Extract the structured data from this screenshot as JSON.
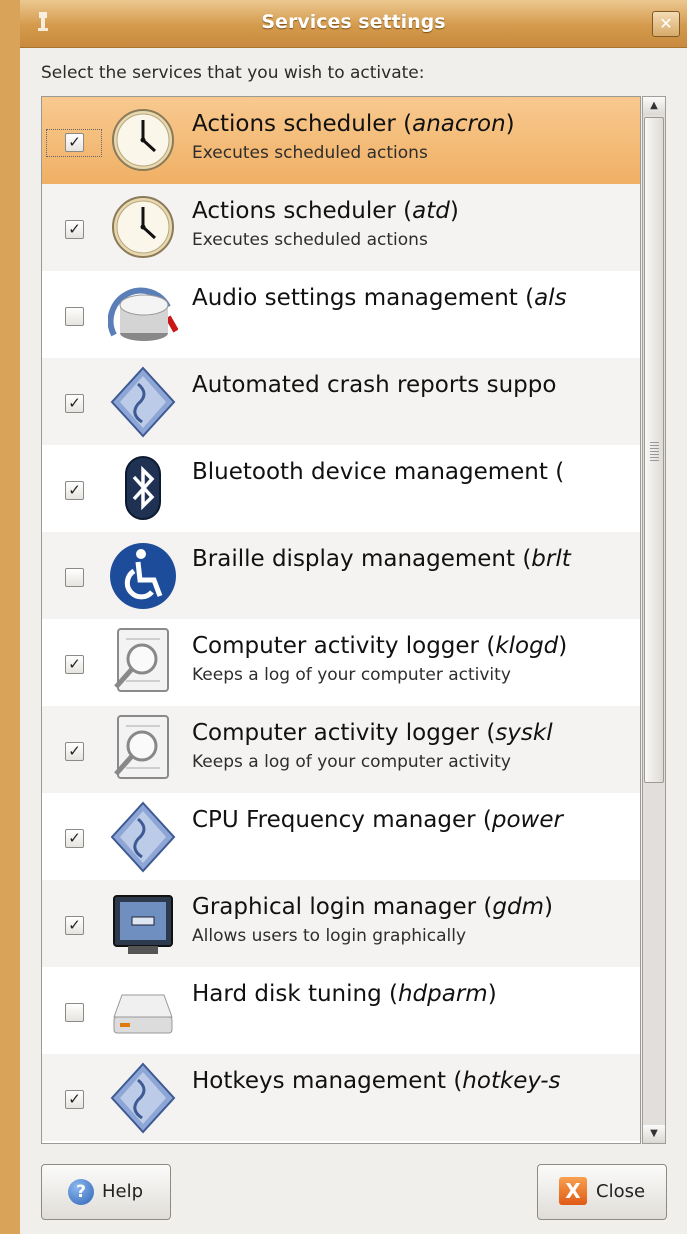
{
  "window": {
    "title": "Services settings",
    "close_glyph": "✕"
  },
  "prompt": "Select the services that you wish to activate:",
  "services": [
    {
      "name": "Actions scheduler (",
      "daemon": "anacron",
      "tail": ")",
      "desc": "Executes scheduled actions",
      "checked": true,
      "selected": true,
      "icon": "clock-icon"
    },
    {
      "name": "Actions scheduler (",
      "daemon": "atd",
      "tail": ")",
      "desc": "Executes scheduled actions",
      "checked": true,
      "icon": "clock-icon"
    },
    {
      "name": "Audio settings management (",
      "daemon": "als",
      "tail": "",
      "desc": "",
      "checked": false,
      "icon": "volume-knob-icon"
    },
    {
      "name": "Automated crash reports suppo",
      "daemon": "",
      "tail": "",
      "desc": "",
      "checked": true,
      "icon": "system-diamond-icon"
    },
    {
      "name": "Bluetooth device management (",
      "daemon": "",
      "tail": "",
      "desc": "",
      "checked": true,
      "icon": "bluetooth-icon"
    },
    {
      "name": "Braille display management (",
      "daemon": "brlt",
      "tail": "",
      "desc": "",
      "checked": false,
      "icon": "accessibility-icon"
    },
    {
      "name": "Computer activity logger (",
      "daemon": "klogd",
      "tail": ")",
      "desc": "Keeps a log of your computer activity",
      "checked": true,
      "icon": "log-viewer-icon"
    },
    {
      "name": "Computer activity logger (",
      "daemon": "syskl",
      "tail": "",
      "desc": "Keeps a log of your computer activity",
      "checked": true,
      "icon": "log-viewer-icon"
    },
    {
      "name": "CPU Frequency manager (",
      "daemon": "power",
      "tail": "",
      "desc": "",
      "checked": true,
      "icon": "system-diamond-icon"
    },
    {
      "name": "Graphical login manager (",
      "daemon": "gdm",
      "tail": ")",
      "desc": "Allows users to login graphically",
      "checked": true,
      "icon": "login-screen-icon"
    },
    {
      "name": "Hard disk tuning (",
      "daemon": "hdparm",
      "tail": ")",
      "desc": "",
      "checked": false,
      "icon": "hard-disk-icon"
    },
    {
      "name": "Hotkeys management (",
      "daemon": "hotkey-s",
      "tail": "",
      "desc": "",
      "checked": true,
      "icon": "system-diamond-icon"
    }
  ],
  "buttons": {
    "help_label": "Help",
    "close_label": "Close"
  },
  "colors": {
    "selected_row": "#f0b065",
    "titlebar": "#d49a4c",
    "desktop": "#d9a35a"
  }
}
